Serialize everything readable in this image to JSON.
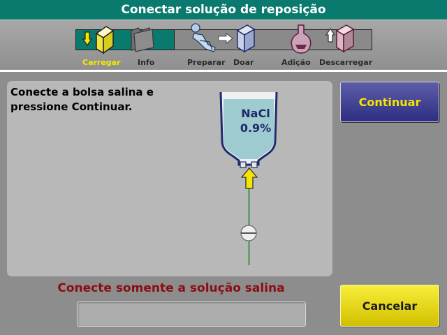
{
  "title": "Conectar solução de reposição",
  "steps": [
    {
      "label": "Carregar",
      "icon": "load-cartridge-icon",
      "state": "current"
    },
    {
      "label": "Info",
      "icon": "folder-icon",
      "state": "pending"
    },
    {
      "label": "Preparar",
      "icon": "patient-icon",
      "state": "pending"
    },
    {
      "label": "Doar",
      "icon": "donate-cartridge-icon",
      "state": "pending"
    },
    {
      "label": "Adição",
      "icon": "flask-icon",
      "state": "pending"
    },
    {
      "label": "Descarregar",
      "icon": "unload-cartridge-icon",
      "state": "pending"
    }
  ],
  "instruction": "Conecte a bolsa salina e pressione Continuar.",
  "bag": {
    "line1": "NaCl",
    "line2": "0.9%"
  },
  "warning": "Conecte somente a solução salina",
  "message": "",
  "buttons": {
    "continue": "Continuar",
    "cancel": "Cancelar"
  },
  "colors": {
    "header": "#0a7a6f",
    "active_step": "#0a7a6f",
    "current_label": "#f8e800",
    "warning_text": "#8b0d12",
    "continue_button": "#3a3a8f",
    "cancel_button": "#e8d81a"
  }
}
